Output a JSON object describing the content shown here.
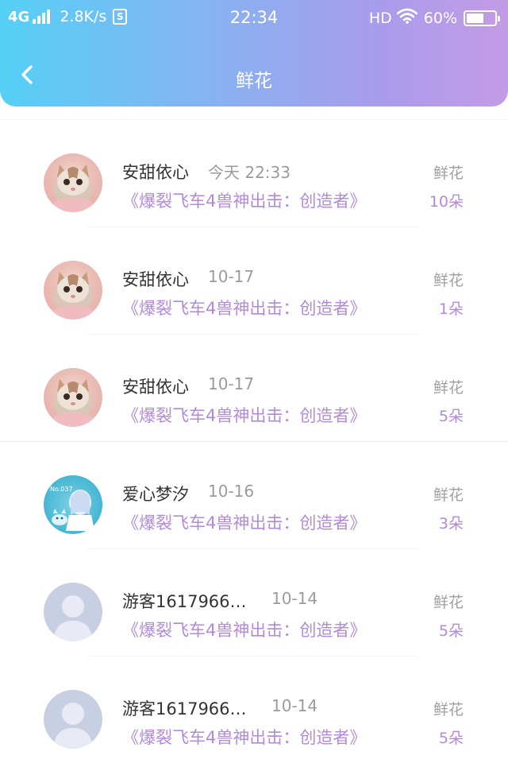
{
  "status_bar": {
    "network": "4G",
    "speed": "2.8K/s",
    "s_icon": "S",
    "time": "22:34",
    "hd": "HD",
    "battery": "60%"
  },
  "header": {
    "title": "鲜花",
    "back_icon": "chevron-left-icon"
  },
  "items": [
    {
      "name": "安甜依心",
      "time": "今天 22:33",
      "book": "《爆裂飞车4兽神出击：创造者》",
      "gift_label": "鲜花",
      "gift_count": "10朵",
      "avatar": "cat"
    },
    {
      "name": "安甜依心",
      "time": "10-17",
      "book": "《爆裂飞车4兽神出击：创造者》",
      "gift_label": "鲜花",
      "gift_count": "1朵",
      "avatar": "cat"
    },
    {
      "name": "安甜依心",
      "time": "10-17",
      "book": "《爆裂飞车4兽神出击：创造者》",
      "gift_label": "鲜花",
      "gift_count": "5朵",
      "avatar": "cat"
    },
    {
      "name": "爱心梦汐",
      "time": "10-16",
      "book": "《爆裂飞车4兽神出击：创造者》",
      "gift_label": "鲜花",
      "gift_count": "3朵",
      "avatar": "anime"
    },
    {
      "name": "游客1617966…",
      "time": "10-14",
      "book": "《爆裂飞车4兽神出击：创造者》",
      "gift_label": "鲜花",
      "gift_count": "5朵",
      "avatar": "default"
    },
    {
      "name": "游客1617966…",
      "time": "10-14",
      "book": "《爆裂飞车4兽神出击：创造者》",
      "gift_label": "鲜花",
      "gift_count": "5朵",
      "avatar": "default"
    }
  ],
  "colors": {
    "accent": "#b28ad8",
    "header_gradient_start": "#55d0f7",
    "header_gradient_end": "#c49be6"
  }
}
